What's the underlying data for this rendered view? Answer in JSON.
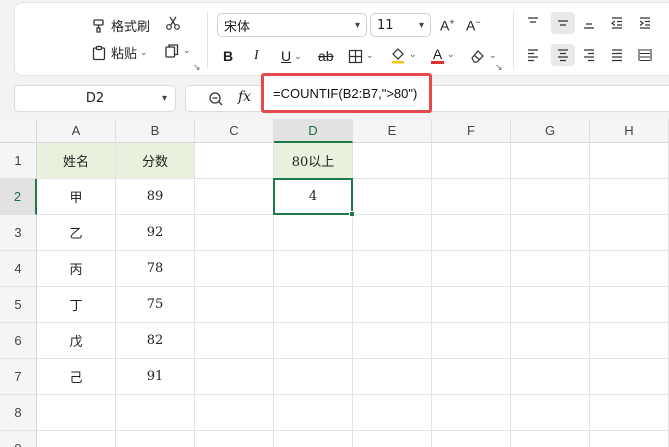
{
  "ribbon": {
    "format_painter": "格式刷",
    "paste": "粘贴",
    "font_name": "宋体",
    "font_size": "11",
    "bold": "B",
    "italic": "I",
    "underline": "U",
    "strike": "ab",
    "font_color_letter": "A",
    "grow_letter": "A",
    "shrink_letter": "A"
  },
  "formula_bar": {
    "name_box": "D2",
    "fx": "fx",
    "formula": "=COUNTIF(B2:B7,\">80\")"
  },
  "sheet": {
    "columns": [
      "A",
      "B",
      "C",
      "D",
      "E",
      "F",
      "G",
      "H"
    ],
    "rows": [
      "1",
      "2",
      "3",
      "4",
      "5",
      "6",
      "7",
      "8",
      "9"
    ],
    "active_cell": "D2",
    "cells": {
      "A1": "姓名",
      "B1": "分数",
      "D1": "80以上",
      "A2": "甲",
      "B2": "89",
      "D2": "4",
      "A3": "乙",
      "B3": "92",
      "A4": "丙",
      "B4": "78",
      "A5": "丁",
      "B5": "75",
      "A6": "戊",
      "B6": "82",
      "A7": "己",
      "B7": "91"
    }
  },
  "colors": {
    "accent_green": "#1f7a47",
    "header_fill": "#e7f1dd",
    "highlight_red": "#e5484d"
  }
}
